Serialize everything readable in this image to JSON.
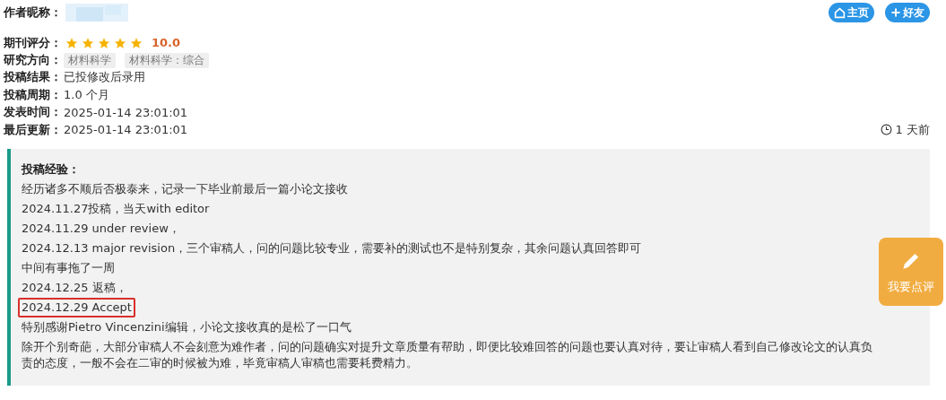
{
  "author": {
    "label": "作者昵称："
  },
  "actions": [
    {
      "kind": "home",
      "label": "主页"
    },
    {
      "kind": "add",
      "label": "好友"
    }
  ],
  "rating": {
    "label": "期刊评分：",
    "stars": 5,
    "score": "10.0"
  },
  "fields": [
    {
      "kind": "tags",
      "label": "研究方向：",
      "tags": [
        "材料科学",
        "材料科学：综合"
      ]
    },
    {
      "kind": "text",
      "label": "投稿结果：",
      "value": "已投修改后录用"
    },
    {
      "kind": "text",
      "label": "投稿周期：",
      "value": "1.0 个月"
    },
    {
      "kind": "text",
      "label": "发表时间：",
      "value": "2025-01-14 23:01:01"
    },
    {
      "kind": "text",
      "label": "最后更新：",
      "value": "2025-01-14 23:01:01"
    }
  ],
  "age": "1 天前",
  "experience": {
    "title": "投稿经验：",
    "lines": [
      {
        "text": "经历诸多不顺后否极泰来，记录一下毕业前最后一篇小论文接收",
        "highlighted": false
      },
      {
        "text": "2024.11.27投稿，当天with editor",
        "highlighted": false
      },
      {
        "text": "2024.11.29 under review，",
        "highlighted": false
      },
      {
        "text": "2024.12.13 major revision，三个审稿人，问的问题比较专业，需要补的测试也不是特别复杂，其余问题认真回答即可",
        "highlighted": false
      },
      {
        "text": "中间有事拖了一周",
        "highlighted": false
      },
      {
        "text": "2024.12.25 返稿，",
        "highlighted": false
      },
      {
        "text": "2024.12.29 Accept",
        "highlighted": true
      },
      {
        "text": "特别感谢Pietro Vincenzini编辑，小论文接收真的是松了一口气",
        "highlighted": false
      },
      {
        "text": "除开个别奇葩，大部分审稿人不会刻意为难作者，问的问题确实对提升文章质量有帮助，即便比较难回答的问题也要认真对待，要让审稿人看到自己修改论文的认真负责的态度，一般不会在二审的时候被为难，毕竟审稿人审稿也需要耗费精力。",
        "highlighted": false
      }
    ]
  },
  "review_button": {
    "label": "我要点评"
  }
}
